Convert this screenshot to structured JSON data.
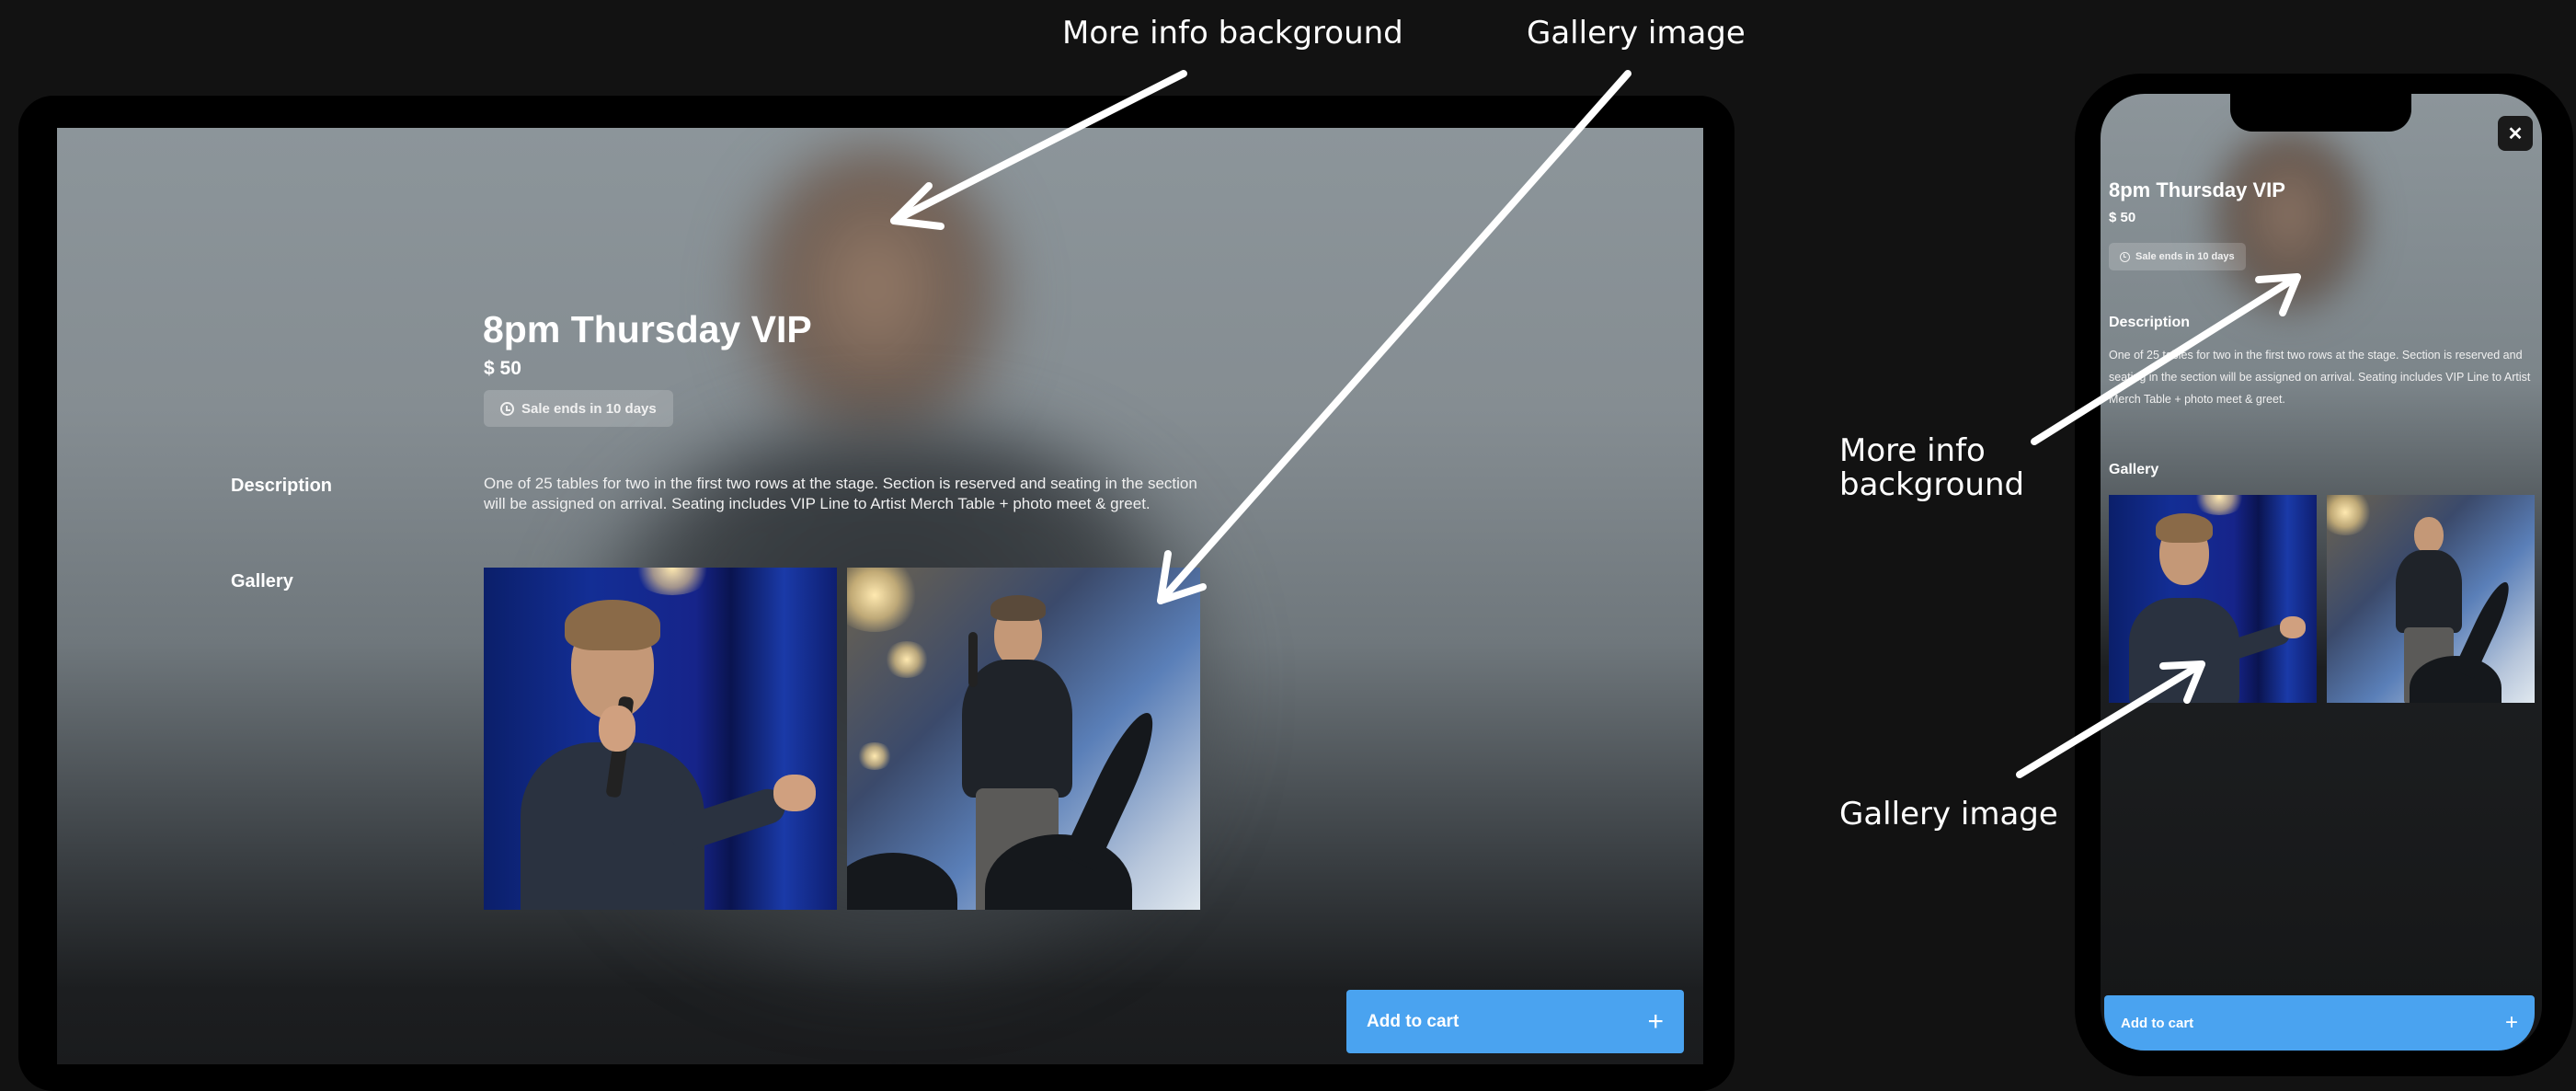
{
  "annotations": {
    "more_info_bg": "More info background",
    "gallery_image": "Gallery image",
    "phone_more_info_bg": "More info background",
    "phone_gallery_image": "Gallery image"
  },
  "ticket": {
    "title": "8pm Thursday VIP",
    "price": "$ 50",
    "sale_badge": "Sale ends in 10 days",
    "description_label": "Description",
    "description": "One of 25 tables for two in the first two rows at the stage. Section is reserved and seating in the section will be assigned on arrival. Seating includes VIP Line to Artist Merch Table + photo meet & greet.",
    "gallery_label": "Gallery",
    "add_to_cart": "Add to cart",
    "plus": "+",
    "close": "✕"
  },
  "icons": {
    "clock": "clock-icon",
    "plus": "plus-icon",
    "close": "close-icon",
    "arrow": "arrow-icon"
  },
  "colors": {
    "page_background": "#121212",
    "accent_button": "#4aa3f0",
    "device_frame": "#000000"
  }
}
